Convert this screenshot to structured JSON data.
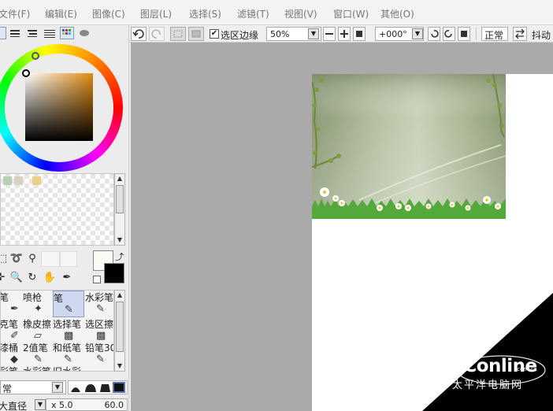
{
  "menu": {
    "items": [
      "文件(F)",
      "编辑(E)",
      "图像(C)",
      "图层(L)",
      "选择(S)",
      "滤镜(T)",
      "视图(V)",
      "窗口(W)",
      "其他(O)"
    ]
  },
  "toolbar": {
    "selection_edge_label": "选区边缘",
    "selection_edge_checked": "✔",
    "zoom_value": "50%",
    "rotation_value": "+000°",
    "blend_label": "正常",
    "stabilizer_label": "抖动"
  },
  "color_panel": {
    "swatches": [
      "#b9cdb7",
      "#d9d2c0",
      "#e8d089"
    ],
    "foreground_color": "#fafaf4",
    "background_color": "#000000"
  },
  "brushes": {
    "items": [
      {
        "label": "笔",
        "icon": "✒"
      },
      {
        "label": "喷枪",
        "icon": "✦"
      },
      {
        "label": "笔",
        "icon": "✎"
      },
      {
        "label": "水彩笔",
        "icon": "✎"
      },
      {
        "label": "克笔",
        "icon": "✐"
      },
      {
        "label": "橡皮擦",
        "icon": "▱"
      },
      {
        "label": "选择笔",
        "icon": "▩"
      },
      {
        "label": "选区擦",
        "icon": "▩"
      },
      {
        "label": "漆桶",
        "icon": "◆"
      },
      {
        "label": "2值笔",
        "icon": "✎"
      },
      {
        "label": "和纸笔",
        "icon": "✎"
      },
      {
        "label": "铅笔30",
        "icon": "✎"
      },
      {
        "label": "彩笔",
        "icon": ""
      },
      {
        "label": "水彩笔",
        "icon": ""
      },
      {
        "label": "旧水彩",
        "icon": ""
      }
    ]
  },
  "brush_settings": {
    "blend_mode": "常",
    "size_label": "大直径",
    "size_multiplier": "x 5.0",
    "size_value": "60.0"
  },
  "watermark": {
    "brand": "PConline",
    "domain": ".com.cn",
    "subtitle": "太平洋电脑网"
  }
}
